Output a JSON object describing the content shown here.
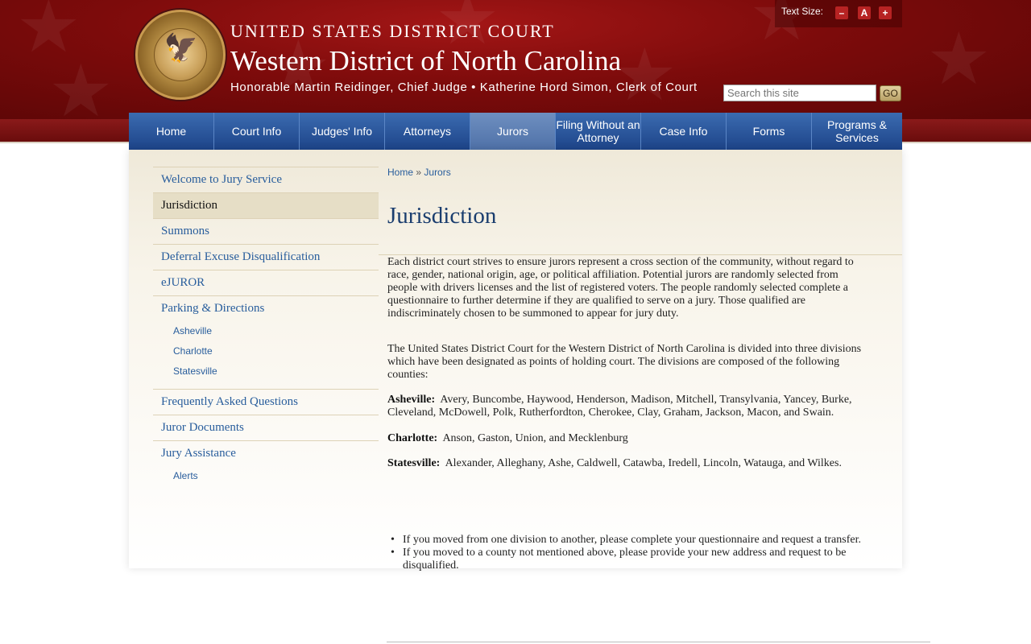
{
  "header": {
    "line1": "UNITED STATES DISTRICT COURT",
    "line2": "Western District of North Carolina",
    "line3": "Honorable Martin Reidinger, Chief Judge • Katherine Hord Simon, Clerk of Court",
    "seal_icon": "court-seal-icon",
    "text_size_label": "Text Size:",
    "text_size_minus": "–",
    "text_size_reset": "A",
    "text_size_plus": "+",
    "search_placeholder": "Search this site",
    "search_button": "GO"
  },
  "nav": {
    "items": [
      {
        "label": "Home"
      },
      {
        "label": "Court Info"
      },
      {
        "label": "Judges' Info"
      },
      {
        "label": "Attorneys"
      },
      {
        "label": "Jurors"
      },
      {
        "label": "Filing Without an Attorney"
      },
      {
        "label": "Case Info"
      },
      {
        "label": "Forms"
      },
      {
        "label": "Programs & Services"
      }
    ],
    "active": "Jurors"
  },
  "sidebar": {
    "items": [
      {
        "label": "Welcome to Jury Service"
      },
      {
        "label": "Jurisdiction"
      },
      {
        "label": "Summons"
      },
      {
        "label": "Deferral Excuse Disqualification"
      },
      {
        "label": "eJUROR"
      },
      {
        "label": "Parking & Directions"
      },
      {
        "label": "Frequently Asked Questions"
      },
      {
        "label": "Juror Documents"
      },
      {
        "label": "Jury Assistance"
      }
    ],
    "parking_subitems": [
      "Asheville",
      "Charlotte",
      "Statesville"
    ],
    "assistance_subitems": [
      "Alerts"
    ]
  },
  "breadcrumb": {
    "home": "Home",
    "separator": "»",
    "current": "Jurors"
  },
  "main": {
    "title": "Jurisdiction",
    "para1": "Each district court strives to ensure jurors represent a cross section of the community, without regard to race, gender, national origin, age, or political affiliation.  Potential jurors are randomly selected from people with drivers licenses and the list of registered voters.  The people randomly selected complete a questionnaire to further determine if they are qualified to serve on a jury. Those qualified are indiscriminately chosen to be summoned to appear for jury duty.",
    "para2": "The United States District Court for the Western District of North Carolina is divided into three divisions which have been designated as points of holding court.  The divisions are composed of the following counties:",
    "divisions": [
      {
        "name": "Asheville:",
        "counties": "Avery, Buncombe, Haywood, Henderson, Madison, Mitchell, Transylvania, Yancey, Burke, Cleveland, McDowell, Polk, Rutherfordton,  Cherokee, Clay, Graham, Jackson, Macon, and Swain."
      },
      {
        "name": "Charlotte:",
        "counties": "Anson, Gaston, Union, and Mecklenburg"
      },
      {
        "name": "Statesville:",
        "counties": "Alexander, Alleghany, Ashe, Caldwell, Catawba, Iredell, Lincoln, Watauga, and Wilkes."
      }
    ],
    "bullets": [
      "If you moved from one division to another, please complete your questionnaire and request a transfer.",
      "If you moved to a county not mentioned above, please provide your new address and request to be disqualified."
    ]
  },
  "colors": {
    "header_red": "#7d0b0b",
    "nav_blue": "#1d4489",
    "link_blue": "#285d9c",
    "title_blue": "#1a3d6e",
    "panel_tan": "#efe9d9"
  }
}
